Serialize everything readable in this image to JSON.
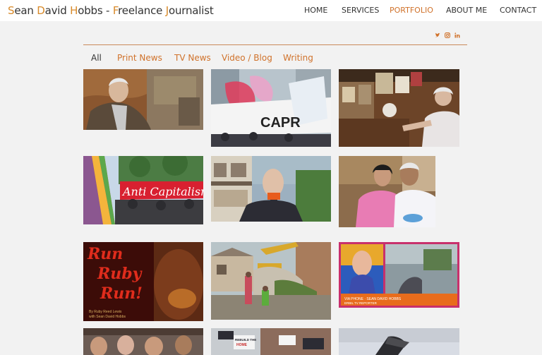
{
  "site": {
    "title_parts": [
      {
        "initial": "S",
        "rest": "ean "
      },
      {
        "initial": "D",
        "rest": "avid "
      },
      {
        "initial": "H",
        "rest": "obbs - "
      },
      {
        "initial": "F",
        "rest": "reelance "
      },
      {
        "initial": "J",
        "rest": "ournalist"
      }
    ]
  },
  "nav": {
    "items": [
      "HOME",
      "SERVICES",
      "PORTFOLIO",
      "ABOUT ME",
      "CONTACT"
    ],
    "active": "PORTFOLIO"
  },
  "social": [
    "twitter-icon",
    "instagram-icon",
    "linkedin-icon"
  ],
  "filters": {
    "items": [
      "All",
      "Print News",
      "TV News",
      "Video / Blog",
      "Writing"
    ],
    "active": "All"
  },
  "thumbnails": {
    "banner_text": "Anti Capitalism",
    "placard_text": "CAPR",
    "book_title": [
      "Run",
      "Ruby",
      "Run!"
    ],
    "book_byline": [
      "By Ruby Reed Lewis",
      "with Sean David Hobbs"
    ],
    "tv_caption": [
      "VIA PHONE · SEAN DAVID HOBBS",
      "ERBIL TV REPORTER"
    ],
    "sign_text": [
      "REBUILD THE",
      "HOME"
    ]
  },
  "colors": {
    "accent": "#d0722b",
    "initial": "#d88a2a",
    "rule": "#c98a5a"
  }
}
